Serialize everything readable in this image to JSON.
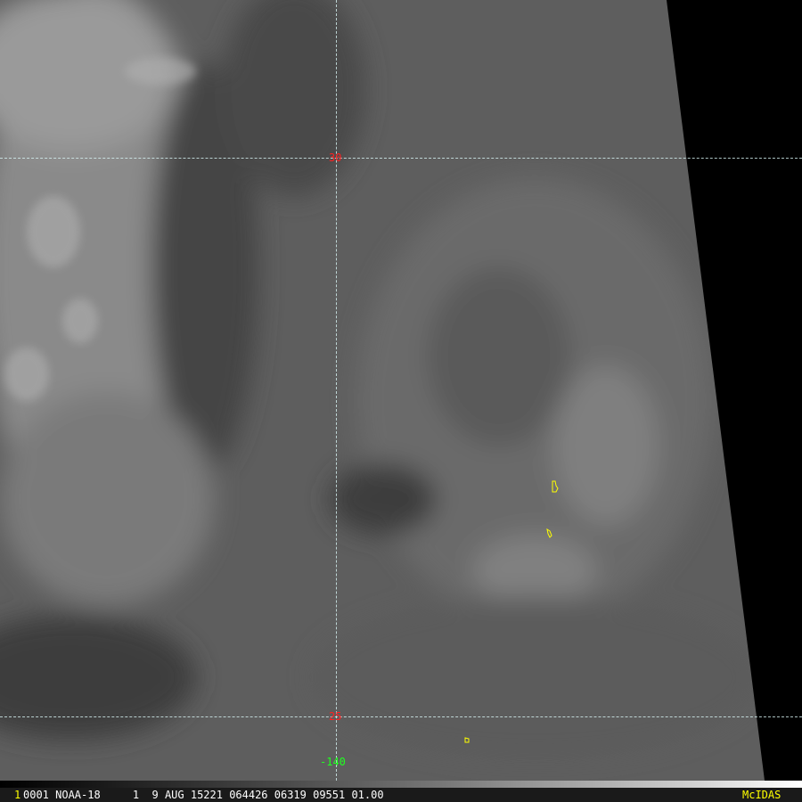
{
  "image": {
    "frame_number": "1",
    "info_line": "0001 NOAA-18     1  9 AUG 15221 064426 06319 09551 01.00",
    "brand": "McIDAS"
  },
  "grid": {
    "lat_labels": [
      "30",
      "25"
    ],
    "lon_labels": [
      "-140"
    ]
  },
  "colors": {
    "lat_label": "#ff2020",
    "lon_label": "#20ff20",
    "grid_line": "#d8f4f4",
    "brand": "#ffff00",
    "coastline": "#ffff00"
  }
}
